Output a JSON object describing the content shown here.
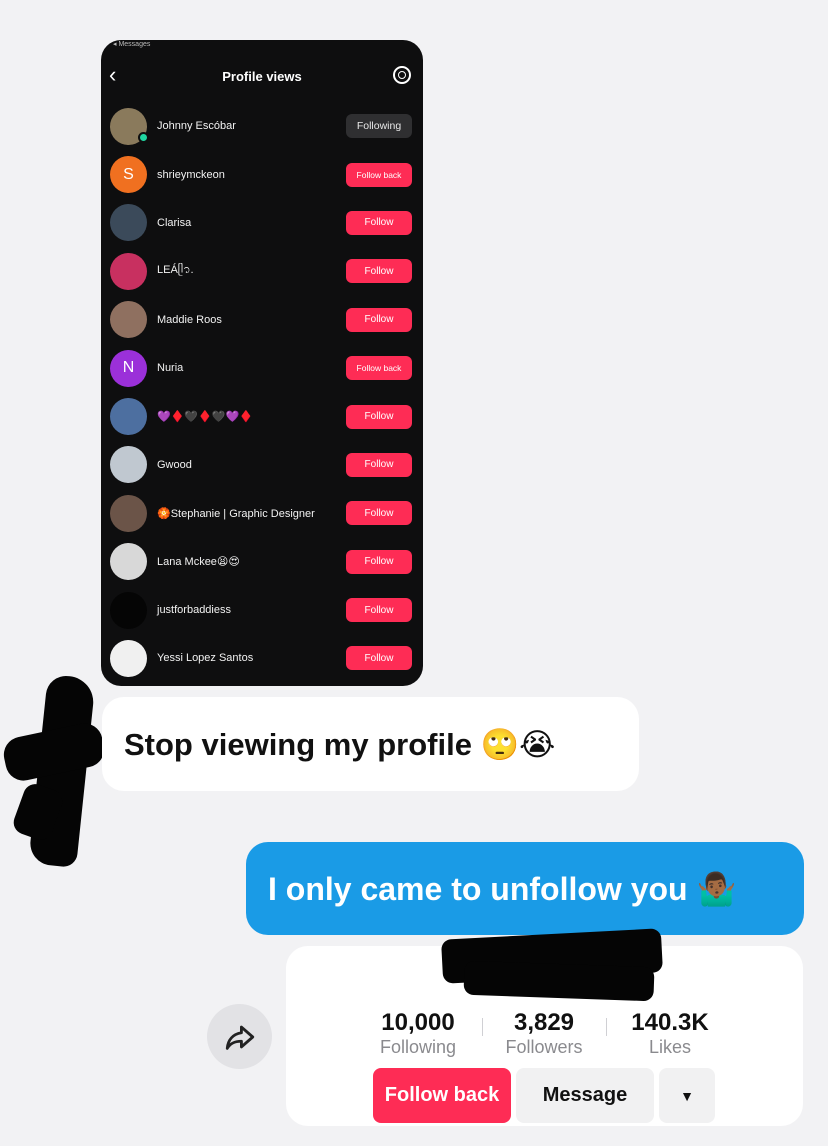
{
  "screenshot": {
    "status_text": "◂ Messages",
    "back_icon": "chevron-left-icon",
    "title": "Profile views",
    "settings_icon": "gear-icon",
    "viewers": [
      {
        "name": "Johnny Escóbar",
        "button": "Following",
        "avatar_color": "#8a7a5c",
        "avatar_letter": ""
      },
      {
        "name": "shrieymckeon",
        "button": "Follow back",
        "avatar_color": "#f07020",
        "avatar_letter": "S"
      },
      {
        "name": "Clarisa",
        "button": "Follow",
        "avatar_color": "#3b4a5a",
        "avatar_letter": ""
      },
      {
        "name": "LEÁᥫ᭡.",
        "button": "Follow",
        "avatar_color": "#c83060",
        "avatar_letter": ""
      },
      {
        "name": "Maddie Roos",
        "button": "Follow",
        "avatar_color": "#8f7060",
        "avatar_letter": ""
      },
      {
        "name": "Nuria",
        "button": "Follow back",
        "avatar_color": "#9b30d9",
        "avatar_letter": "N"
      },
      {
        "name": "💜♦️🖤♦️🖤💜♦️",
        "button": "Follow",
        "avatar_color": "#4d6fa0",
        "avatar_letter": ""
      },
      {
        "name": "Gwood",
        "button": "Follow",
        "avatar_color": "#c0c8d0",
        "avatar_letter": ""
      },
      {
        "name": "🏵️Stephanie | Graphic Designer",
        "button": "Follow",
        "avatar_color": "#6b5448",
        "avatar_letter": ""
      },
      {
        "name": "Lana Mckee😫😍",
        "button": "Follow",
        "avatar_color": "#d8d8d8",
        "avatar_letter": ""
      },
      {
        "name": "justforbaddiess",
        "button": "Follow",
        "avatar_color": "#050505",
        "avatar_letter": ""
      },
      {
        "name": "Yessi Lopez Santos",
        "button": "Follow",
        "avatar_color": "#f0f0f0",
        "avatar_letter": ""
      }
    ]
  },
  "chat": {
    "incoming": "Stop viewing my profile 🙄😭",
    "outgoing": "I only came to unfollow you 🤷🏾‍♂️"
  },
  "profile_card": {
    "share_icon": "share-arrow-icon",
    "stats": [
      {
        "value": "10,000",
        "label": "Following"
      },
      {
        "value": "3,829",
        "label": "Followers"
      },
      {
        "value": "140.3K",
        "label": "Likes"
      }
    ],
    "follow_back_label": "Follow back",
    "message_label": "Message",
    "more_icon": "caret-down-icon"
  },
  "colors": {
    "tiktok_red": "#fe2c55",
    "imessage_blue": "#1a9be6",
    "background": "#f2f2f4"
  }
}
